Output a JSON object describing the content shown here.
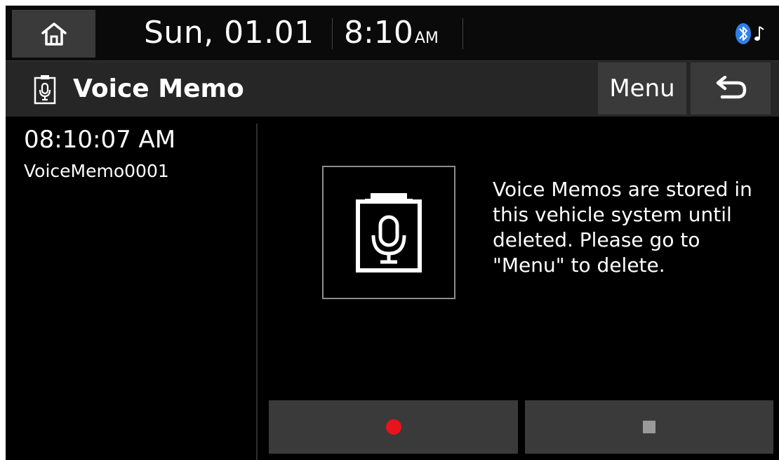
{
  "status_bar": {
    "date": "Sun, 01.01",
    "time": "8:10",
    "ampm": "AM",
    "icons": {
      "home": "home-icon",
      "bluetooth": "bluetooth-audio-icon"
    }
  },
  "title_bar": {
    "title": "Voice Memo",
    "menu_label": "Menu",
    "icons": {
      "title": "voice-memo-icon",
      "back": "back-arrow-icon"
    }
  },
  "memo_list": [
    {
      "time": "08:10:07 AM",
      "name": "VoiceMemo0001"
    }
  ],
  "main": {
    "info_text": "Voice Memos are stored in this vehicle system until deleted. Please go to \"Menu\" to delete.",
    "icon": "voice-memo-icon"
  },
  "controls": {
    "record_icon": "record-icon",
    "stop_icon": "stop-icon"
  },
  "colors": {
    "background": "#000000",
    "bar": "#262626",
    "button": "#3a3a3a",
    "record": "#e8131b",
    "bluetooth": "#2f7fe6"
  }
}
